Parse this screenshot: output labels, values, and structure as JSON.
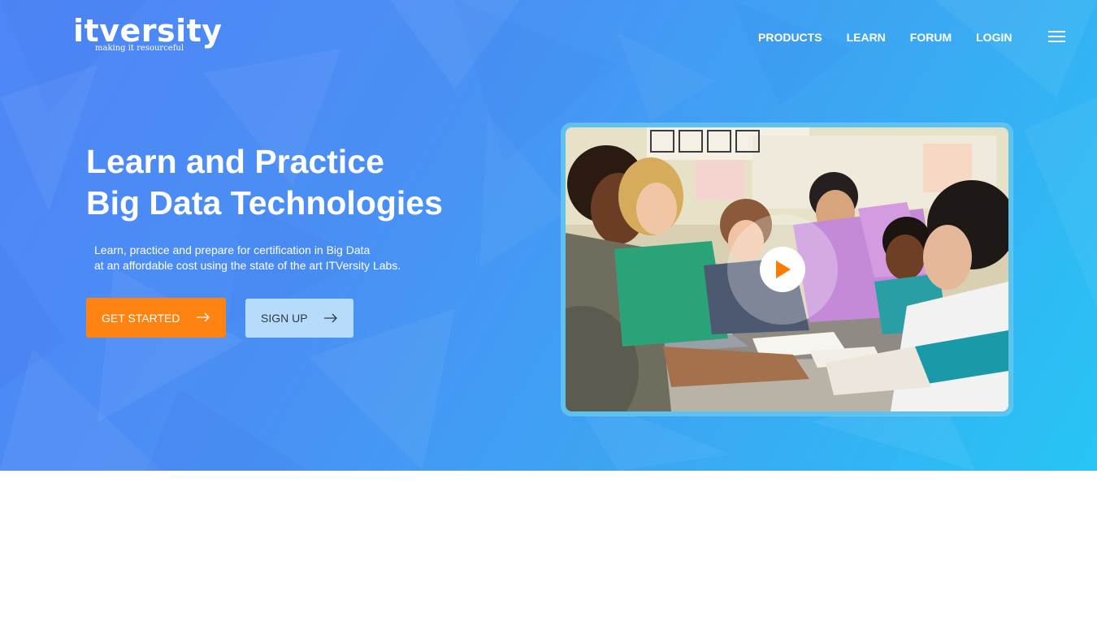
{
  "brand": {
    "name": "itversity",
    "tagline": "making it resourceful"
  },
  "nav": {
    "items": [
      "PRODUCTS",
      "LEARN",
      "FORUM",
      "LOGIN"
    ]
  },
  "hero": {
    "title_line1": "Learn and Practice",
    "title_line2": "Big Data Technologies",
    "subtitle_line1": "Learn, practice and prepare for certification in Big Data",
    "subtitle_line2": "at an affordable cost using the state of the art ITVersity Labs.",
    "cta_primary": "GET STARTED",
    "cta_secondary": "SIGN UP"
  },
  "colors": {
    "primary_button": "#ff8310",
    "secondary_button": "#b7dcfb",
    "hero_gradient_start": "#4f86f7",
    "hero_gradient_end": "#27c5f5"
  },
  "icons": {
    "menu": "hamburger-icon",
    "arrow": "arrow-right-icon",
    "play": "play-icon"
  }
}
